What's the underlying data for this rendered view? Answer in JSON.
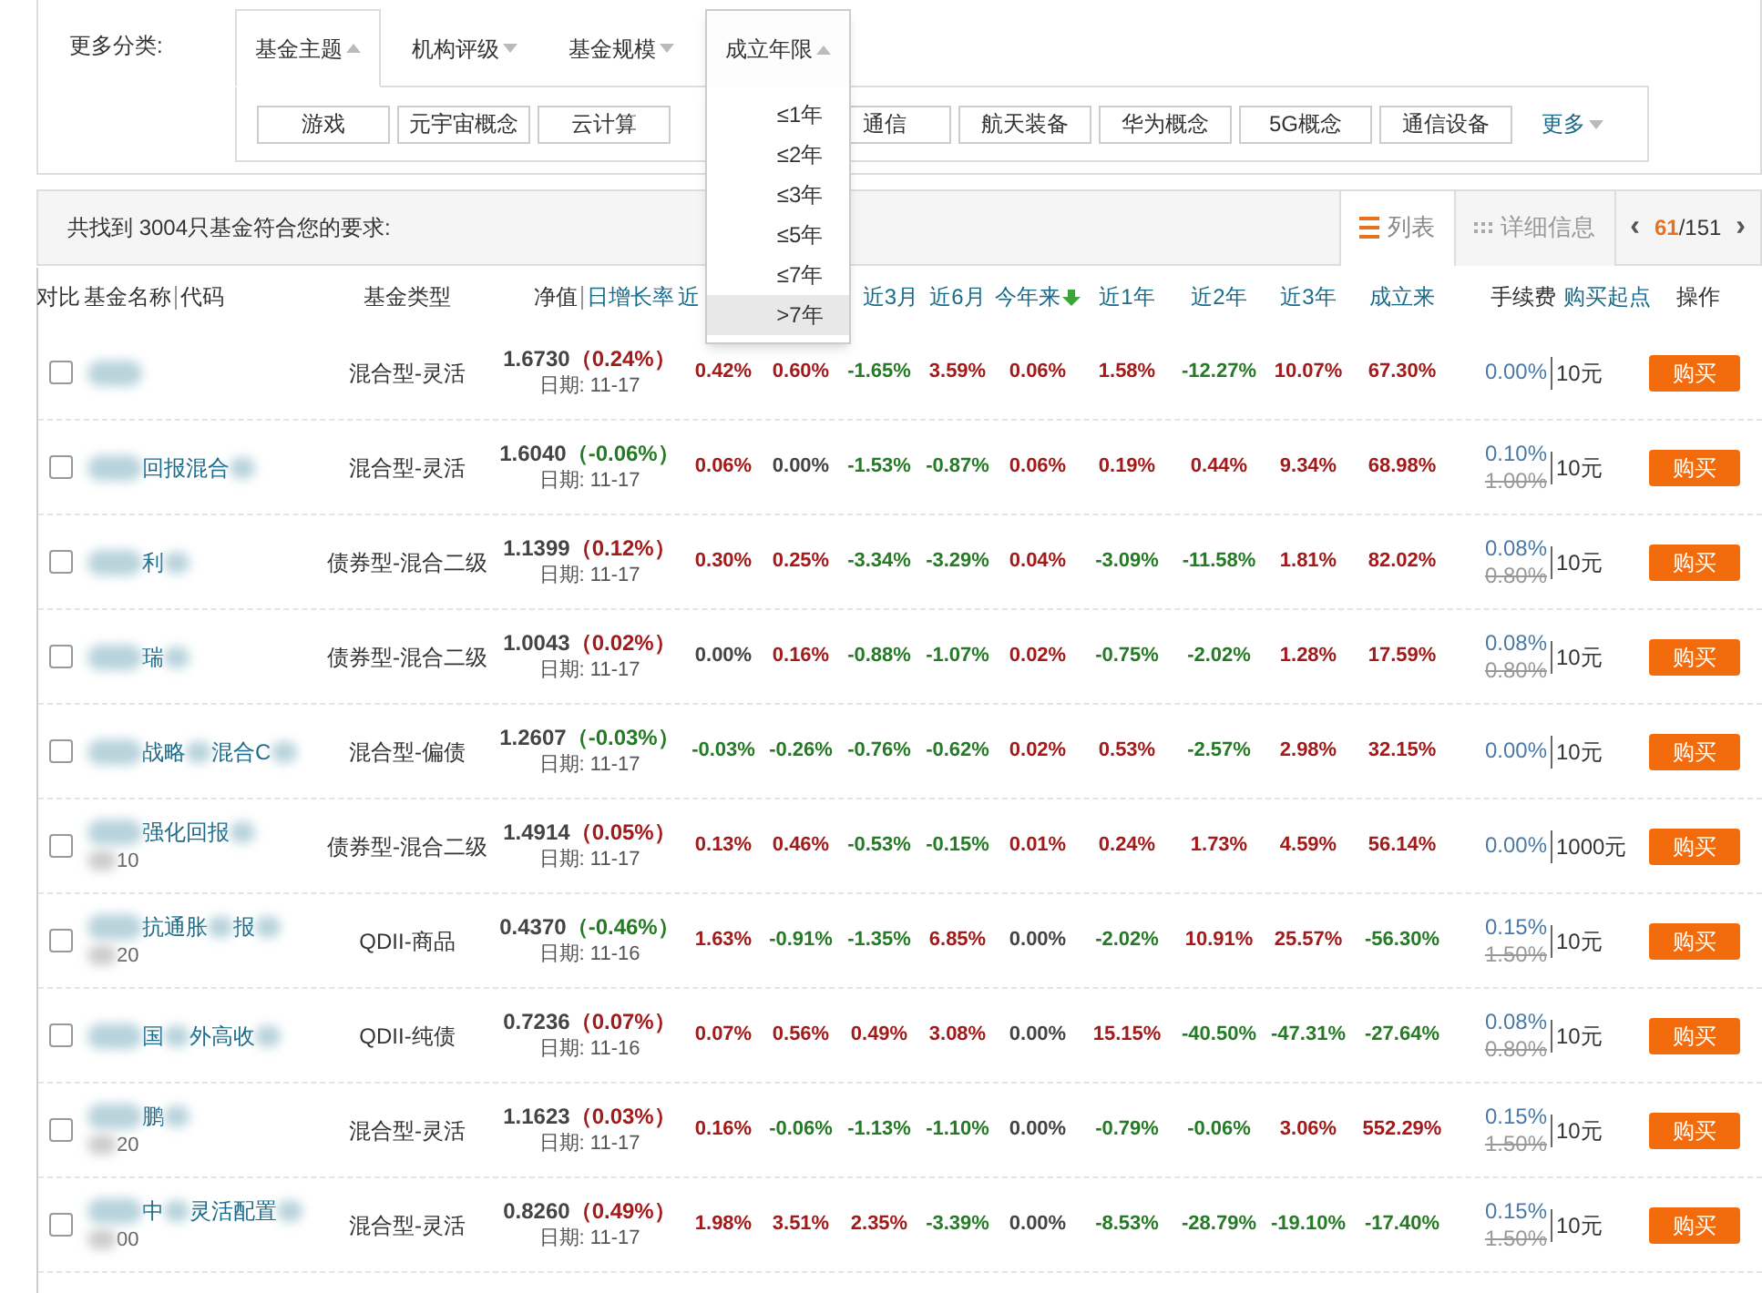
{
  "filter": {
    "label": "更多分类:",
    "tabs": [
      {
        "label": "基金主题",
        "selected": true,
        "expanded": false
      },
      {
        "label": "机构评级",
        "selected": false,
        "expanded": false
      },
      {
        "label": "基金规模",
        "selected": false,
        "expanded": false
      },
      {
        "label": "成立年限",
        "selected": false,
        "expanded": true
      }
    ],
    "tags": [
      "游戏",
      "元宇宙概念",
      "云计算",
      "通信",
      "航天装备",
      "华为概念",
      "5G概念",
      "通信设备"
    ],
    "more": "更多",
    "dropdown": [
      {
        "label": "≤1年",
        "selected": false
      },
      {
        "label": "≤2年",
        "selected": false
      },
      {
        "label": "≤3年",
        "selected": false
      },
      {
        "label": "≤5年",
        "selected": false
      },
      {
        "label": "≤7年",
        "selected": false
      },
      {
        "label": ">7年",
        "selected": true
      }
    ]
  },
  "results": {
    "summary": "共找到 3004只基金符合您的要求:",
    "views": [
      {
        "label": "列表",
        "selected": true,
        "kind": "list"
      },
      {
        "label": "详细信息",
        "selected": false,
        "kind": "grid"
      }
    ],
    "prev": "‹",
    "page": "61",
    "pages": "/151",
    "next": "›"
  },
  "columns": [
    {
      "label": "对比"
    },
    {
      "label": "基金名称",
      "link": false
    },
    {
      "label": "代码"
    },
    {
      "label": "基金类型"
    },
    {
      "label": "净值"
    },
    {
      "label": "日增长率",
      "link": true
    },
    {
      "label": "近",
      "link": true
    },
    {
      "label": "近3月",
      "link": true
    },
    {
      "label": "近6月",
      "link": true
    },
    {
      "label": "今年来",
      "link": true,
      "sorted": true
    },
    {
      "label": "近1年",
      "link": true
    },
    {
      "label": "近2年",
      "link": true
    },
    {
      "label": "近3年",
      "link": true
    },
    {
      "label": "成立来",
      "link": true
    },
    {
      "label": "手续费"
    },
    {
      "label": "购买起点",
      "link": true
    },
    {
      "label": "操作"
    }
  ],
  "rows": [
    {
      "checked": false,
      "name_parts": [],
      "type": "混合型-灵活",
      "nav": "1.6730",
      "daily": {
        "v": "（0.24%）",
        "color": "#a31a1a"
      },
      "date": "日期: 11-17",
      "returns": [
        {
          "v": "0.42%",
          "color": "#a31a1a"
        },
        {
          "v": "0.60%",
          "color": "#a31a1a"
        },
        {
          "v": "-1.65%",
          "color": "#257a25"
        },
        {
          "v": "3.59%",
          "color": "#a31a1a"
        },
        {
          "v": "0.06%",
          "color": "#a31a1a"
        },
        {
          "v": "1.58%",
          "color": "#a31a1a"
        },
        {
          "v": "-12.27%",
          "color": "#257a25"
        },
        {
          "v": "10.07%",
          "color": "#a31a1a"
        },
        {
          "v": "67.30%",
          "color": "#a31a1a"
        }
      ],
      "fee": "0.00%",
      "min_buy": "10元",
      "button": "购买"
    },
    {
      "checked": false,
      "name_parts": [
        "回报混合"
      ],
      "type": "混合型-灵活",
      "nav": "1.6040",
      "daily": {
        "v": "（-0.06%）",
        "color": "#257a25"
      },
      "date": "日期: 11-17",
      "returns": [
        {
          "v": "0.06%",
          "color": "#a31a1a"
        },
        {
          "v": "0.00%",
          "color": "#444444"
        },
        {
          "v": "-1.53%",
          "color": "#257a25"
        },
        {
          "v": "-0.87%",
          "color": "#257a25"
        },
        {
          "v": "0.06%",
          "color": "#a31a1a"
        },
        {
          "v": "0.19%",
          "color": "#a31a1a"
        },
        {
          "v": "0.44%",
          "color": "#a31a1a"
        },
        {
          "v": "9.34%",
          "color": "#a31a1a"
        },
        {
          "v": "68.98%",
          "color": "#a31a1a"
        }
      ],
      "fee": "0.10%",
      "fee_original": "1.00%",
      "min_buy": "10元",
      "button": "购买"
    },
    {
      "checked": false,
      "name_parts": [
        "利"
      ],
      "type": "债券型-混合二级",
      "nav": "1.1399",
      "daily": {
        "v": "（0.12%）",
        "color": "#a31a1a"
      },
      "date": "日期: 11-17",
      "returns": [
        {
          "v": "0.30%",
          "color": "#a31a1a"
        },
        {
          "v": "0.25%",
          "color": "#a31a1a"
        },
        {
          "v": "-3.34%",
          "color": "#257a25"
        },
        {
          "v": "-3.29%",
          "color": "#257a25"
        },
        {
          "v": "0.04%",
          "color": "#a31a1a"
        },
        {
          "v": "-3.09%",
          "color": "#257a25"
        },
        {
          "v": "-11.58%",
          "color": "#257a25"
        },
        {
          "v": "1.81%",
          "color": "#a31a1a"
        },
        {
          "v": "82.02%",
          "color": "#a31a1a"
        }
      ],
      "fee": "0.08%",
      "fee_original": "0.80%",
      "min_buy": "10元",
      "button": "购买"
    },
    {
      "checked": false,
      "name_parts": [
        "瑞"
      ],
      "type": "债券型-混合二级",
      "nav": "1.0043",
      "daily": {
        "v": "（0.02%）",
        "color": "#a31a1a"
      },
      "date": "日期: 11-17",
      "returns": [
        {
          "v": "0.00%",
          "color": "#444444"
        },
        {
          "v": "0.16%",
          "color": "#a31a1a"
        },
        {
          "v": "-0.88%",
          "color": "#257a25"
        },
        {
          "v": "-1.07%",
          "color": "#257a25"
        },
        {
          "v": "0.02%",
          "color": "#a31a1a"
        },
        {
          "v": "-0.75%",
          "color": "#257a25"
        },
        {
          "v": "-2.02%",
          "color": "#257a25"
        },
        {
          "v": "1.28%",
          "color": "#a31a1a"
        },
        {
          "v": "17.59%",
          "color": "#a31a1a"
        }
      ],
      "fee": "0.08%",
      "fee_original": "0.80%",
      "min_buy": "10元",
      "button": "购买"
    },
    {
      "checked": false,
      "name_parts": [
        "战略",
        "混合C"
      ],
      "type": "混合型-偏债",
      "nav": "1.2607",
      "daily": {
        "v": "（-0.03%）",
        "color": "#257a25"
      },
      "date": "日期: 11-17",
      "returns": [
        {
          "v": "-0.03%",
          "color": "#257a25"
        },
        {
          "v": "-0.26%",
          "color": "#257a25"
        },
        {
          "v": "-0.76%",
          "color": "#257a25"
        },
        {
          "v": "-0.62%",
          "color": "#257a25"
        },
        {
          "v": "0.02%",
          "color": "#a31a1a"
        },
        {
          "v": "0.53%",
          "color": "#a31a1a"
        },
        {
          "v": "-2.57%",
          "color": "#257a25"
        },
        {
          "v": "2.98%",
          "color": "#a31a1a"
        },
        {
          "v": "32.15%",
          "color": "#a31a1a"
        }
      ],
      "fee": "0.00%",
      "min_buy": "10元",
      "button": "购买"
    },
    {
      "checked": false,
      "name_parts": [
        "强化回报"
      ],
      "code": "10",
      "type": "债券型-混合二级",
      "nav": "1.4914",
      "daily": {
        "v": "（0.05%）",
        "color": "#a31a1a"
      },
      "date": "日期: 11-17",
      "returns": [
        {
          "v": "0.13%",
          "color": "#a31a1a"
        },
        {
          "v": "0.46%",
          "color": "#a31a1a"
        },
        {
          "v": "-0.53%",
          "color": "#257a25"
        },
        {
          "v": "-0.15%",
          "color": "#257a25"
        },
        {
          "v": "0.01%",
          "color": "#a31a1a"
        },
        {
          "v": "0.24%",
          "color": "#a31a1a"
        },
        {
          "v": "1.73%",
          "color": "#a31a1a"
        },
        {
          "v": "4.59%",
          "color": "#a31a1a"
        },
        {
          "v": "56.14%",
          "color": "#a31a1a"
        }
      ],
      "fee": "0.00%",
      "min_buy": "1000元",
      "button": "购买"
    },
    {
      "checked": false,
      "name_parts": [
        "抗通胀",
        "报"
      ],
      "code": "20",
      "type": "QDII-商品",
      "nav": "0.4370",
      "daily": {
        "v": "（-0.46%）",
        "color": "#257a25"
      },
      "date": "日期: 11-16",
      "returns": [
        {
          "v": "1.63%",
          "color": "#a31a1a"
        },
        {
          "v": "-0.91%",
          "color": "#257a25"
        },
        {
          "v": "-1.35%",
          "color": "#257a25"
        },
        {
          "v": "6.85%",
          "color": "#a31a1a"
        },
        {
          "v": "0.00%",
          "color": "#444444"
        },
        {
          "v": "-2.02%",
          "color": "#257a25"
        },
        {
          "v": "10.91%",
          "color": "#a31a1a"
        },
        {
          "v": "25.57%",
          "color": "#a31a1a"
        },
        {
          "v": "-56.30%",
          "color": "#257a25"
        }
      ],
      "fee": "0.15%",
      "fee_original": "1.50%",
      "min_buy": "10元",
      "button": "购买"
    },
    {
      "checked": false,
      "name_parts": [
        "国",
        "外高收"
      ],
      "type": "QDII-纯债",
      "nav": "0.7236",
      "daily": {
        "v": "（0.07%）",
        "color": "#a31a1a"
      },
      "date": "日期: 11-16",
      "returns": [
        {
          "v": "0.07%",
          "color": "#a31a1a"
        },
        {
          "v": "0.56%",
          "color": "#a31a1a"
        },
        {
          "v": "0.49%",
          "color": "#a31a1a"
        },
        {
          "v": "3.08%",
          "color": "#a31a1a"
        },
        {
          "v": "0.00%",
          "color": "#444444"
        },
        {
          "v": "15.15%",
          "color": "#a31a1a"
        },
        {
          "v": "-40.50%",
          "color": "#257a25"
        },
        {
          "v": "-47.31%",
          "color": "#257a25"
        },
        {
          "v": "-27.64%",
          "color": "#257a25"
        }
      ],
      "fee": "0.08%",
      "fee_original": "0.80%",
      "min_buy": "10元",
      "button": "购买"
    },
    {
      "checked": false,
      "name_parts": [
        "鹏"
      ],
      "code": "20",
      "type": "混合型-灵活",
      "nav": "1.1623",
      "daily": {
        "v": "（0.03%）",
        "color": "#a31a1a"
      },
      "date": "日期: 11-17",
      "returns": [
        {
          "v": "0.16%",
          "color": "#a31a1a"
        },
        {
          "v": "-0.06%",
          "color": "#257a25"
        },
        {
          "v": "-1.13%",
          "color": "#257a25"
        },
        {
          "v": "-1.10%",
          "color": "#257a25"
        },
        {
          "v": "0.00%",
          "color": "#444444"
        },
        {
          "v": "-0.79%",
          "color": "#257a25"
        },
        {
          "v": "-0.06%",
          "color": "#257a25"
        },
        {
          "v": "3.06%",
          "color": "#a31a1a"
        },
        {
          "v": "552.29%",
          "color": "#a31a1a"
        }
      ],
      "fee": "0.15%",
      "fee_original": "1.50%",
      "min_buy": "10元",
      "button": "购买"
    },
    {
      "checked": false,
      "name_parts": [
        "中",
        "灵活配置"
      ],
      "code": "00",
      "type": "混合型-灵活",
      "nav": "0.8260",
      "daily": {
        "v": "（0.49%）",
        "color": "#a31a1a"
      },
      "date": "日期: 11-17",
      "returns": [
        {
          "v": "1.98%",
          "color": "#a31a1a"
        },
        {
          "v": "3.51%",
          "color": "#a31a1a"
        },
        {
          "v": "2.35%",
          "color": "#a31a1a"
        },
        {
          "v": "-3.39%",
          "color": "#257a25"
        },
        {
          "v": "0.00%",
          "color": "#444444"
        },
        {
          "v": "-8.53%",
          "color": "#257a25"
        },
        {
          "v": "-28.79%",
          "color": "#257a25"
        },
        {
          "v": "-19.10%",
          "color": "#257a25"
        },
        {
          "v": "-17.40%",
          "color": "#257a25"
        }
      ],
      "fee": "0.15%",
      "fee_original": "1.50%",
      "min_buy": "10元",
      "button": "购买"
    }
  ]
}
